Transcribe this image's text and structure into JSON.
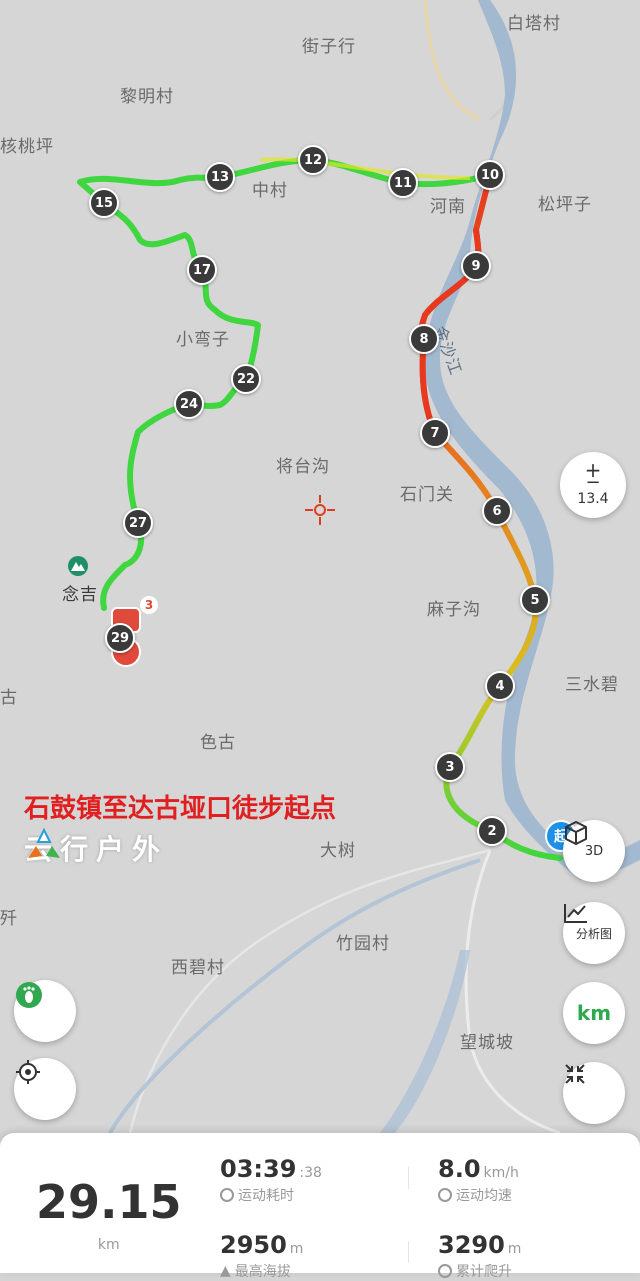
{
  "map": {
    "places": [
      {
        "name": "白塔村"
      },
      {
        "name": "街子行"
      },
      {
        "name": "黎明村"
      },
      {
        "name": "核桃坪"
      },
      {
        "name": "中村"
      },
      {
        "name": "河南"
      },
      {
        "name": "松坪子"
      },
      {
        "name": "小弯子"
      },
      {
        "name": "将台沟"
      },
      {
        "name": "石门关"
      },
      {
        "name": "金沙江"
      },
      {
        "name": "念吉"
      },
      {
        "name": "麻子沟"
      },
      {
        "name": "三水碧"
      },
      {
        "name": "古"
      },
      {
        "name": "色古"
      },
      {
        "name": "大树"
      },
      {
        "name": "竹园村"
      },
      {
        "name": "西碧村"
      },
      {
        "name": "望城坡"
      },
      {
        "name": "歼"
      }
    ],
    "markers": [
      "2",
      "3",
      "4",
      "5",
      "6",
      "7",
      "8",
      "9",
      "10",
      "11",
      "12",
      "13",
      "15",
      "17",
      "22",
      "24",
      "27",
      "29"
    ],
    "photo_badge": "3",
    "start_label": "起",
    "caption": "石鼓镇至达古垭口徒步起点",
    "brand": "云行户外",
    "colors": {
      "track_green": "#3fd63f",
      "track_red": "#e03c20",
      "river": "#9ab4cf",
      "caption": "#e02020"
    }
  },
  "controls": {
    "zoom_plus": "+",
    "zoom_minus": "−",
    "zoom_level": "13.4",
    "btn_3d": "3D",
    "btn_analysis": "分析图",
    "btn_unit": "km",
    "icons": [
      "footprint-icon",
      "locate-icon",
      "cube-icon",
      "chart-icon",
      "collapse-icon"
    ]
  },
  "stats": {
    "distance_value": "29.15",
    "distance_unit": "km",
    "duration_value": "03:39",
    "duration_seconds": ":38",
    "duration_label": "运动耗时",
    "speed_value": "8.0",
    "speed_unit": "km/h",
    "speed_label": "运动均速",
    "max_alt_value": "2950",
    "max_alt_unit": "m",
    "max_alt_label": "最高海拔",
    "climb_value": "3290",
    "climb_unit": "m",
    "climb_label": "累计爬升"
  }
}
